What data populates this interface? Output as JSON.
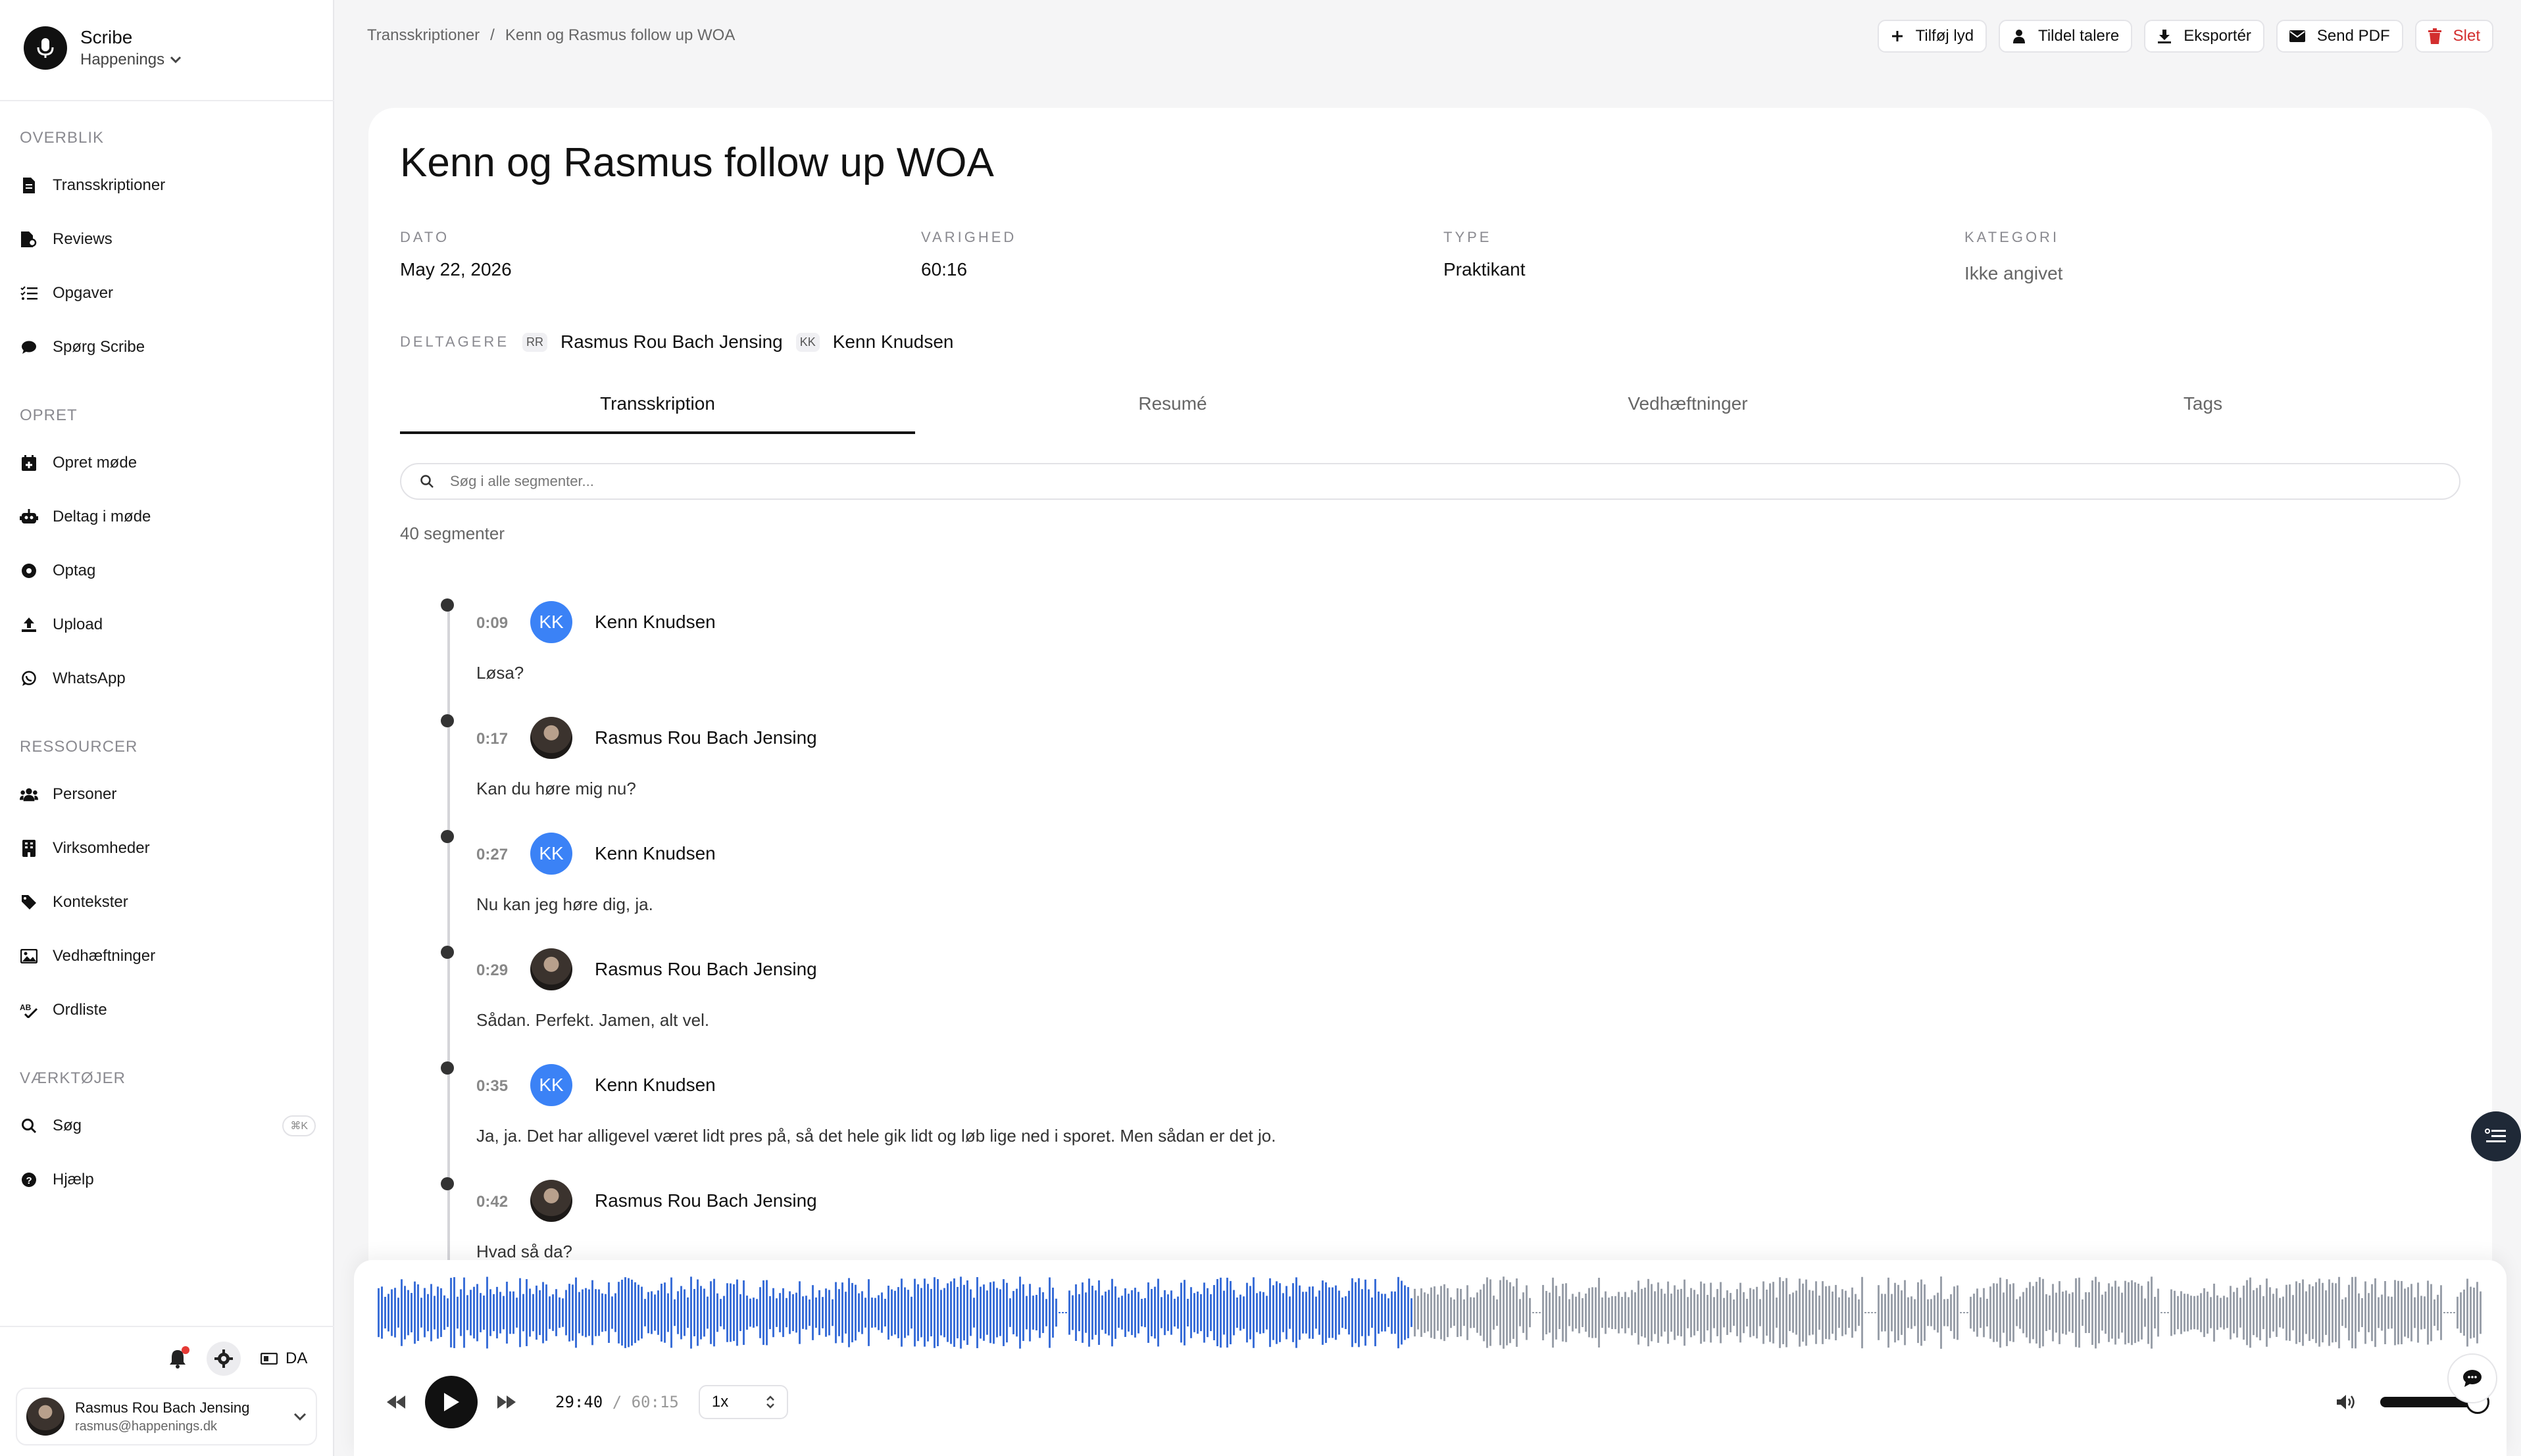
{
  "app": {
    "name": "Scribe",
    "org": "Happenings"
  },
  "sidebar": {
    "sections": [
      {
        "title": "OVERBLIK",
        "items": [
          {
            "label": "Transskriptioner",
            "icon": "file-icon"
          },
          {
            "label": "Reviews",
            "icon": "file-search-icon"
          },
          {
            "label": "Opgaver",
            "icon": "list-check-icon"
          },
          {
            "label": "Spørg Scribe",
            "icon": "chat-bubble-icon"
          }
        ]
      },
      {
        "title": "OPRET",
        "items": [
          {
            "label": "Opret møde",
            "icon": "calendar-plus-icon"
          },
          {
            "label": "Deltag i møde",
            "icon": "robot-icon"
          },
          {
            "label": "Optag",
            "icon": "record-icon"
          },
          {
            "label": "Upload",
            "icon": "upload-icon"
          },
          {
            "label": "WhatsApp",
            "icon": "whatsapp-icon"
          }
        ]
      },
      {
        "title": "RESSOURCER",
        "items": [
          {
            "label": "Personer",
            "icon": "people-icon"
          },
          {
            "label": "Virksomheder",
            "icon": "building-icon"
          },
          {
            "label": "Kontekster",
            "icon": "tag-icon"
          },
          {
            "label": "Vedhæftninger",
            "icon": "image-icon"
          },
          {
            "label": "Ordliste",
            "icon": "spellcheck-icon"
          }
        ]
      },
      {
        "title": "VÆRKTØJER",
        "items": [
          {
            "label": "Søg",
            "icon": "search-icon",
            "shortcut": "⌘K"
          },
          {
            "label": "Hjælp",
            "icon": "help-icon"
          }
        ]
      }
    ],
    "language": "DA",
    "user": {
      "name": "Rasmus Rou Bach Jensing",
      "email": "rasmus@happenings.dk"
    }
  },
  "topbar": {
    "breadcrumb": [
      "Transskriptioner",
      "Kenn og Rasmus follow up WOA"
    ],
    "actions": {
      "add_audio": "Tilføj lyd",
      "assign_speakers": "Tildel talere",
      "export": "Eksportér",
      "send_pdf": "Send PDF",
      "delete": "Slet"
    }
  },
  "meeting": {
    "title": "Kenn og Rasmus follow up WOA",
    "meta": {
      "date_label": "DATO",
      "date": "May 22, 2026",
      "duration_label": "VARIGHED",
      "duration": "60:16",
      "type_label": "TYPE",
      "type": "Praktikant",
      "category_label": "KATEGORI",
      "category": "Ikke angivet"
    },
    "participants_label": "DELTAGERE",
    "participants": [
      {
        "initials": "RR",
        "name": "Rasmus Rou Bach Jensing"
      },
      {
        "initials": "KK",
        "name": "Kenn Knudsen"
      }
    ]
  },
  "tabs": [
    "Transskription",
    "Resumé",
    "Vedhæftninger",
    "Tags"
  ],
  "search": {
    "placeholder": "Søg i alle segmenter..."
  },
  "segment_count": "40 segmenter",
  "segments": [
    {
      "time": "0:09",
      "speaker": "Kenn Knudsen",
      "initials": "KK",
      "text": "Løsa?"
    },
    {
      "time": "0:17",
      "speaker": "Rasmus Rou Bach Jensing",
      "initials": "",
      "text": "Kan du høre mig nu?"
    },
    {
      "time": "0:27",
      "speaker": "Kenn Knudsen",
      "initials": "KK",
      "text": "Nu kan jeg høre dig, ja."
    },
    {
      "time": "0:29",
      "speaker": "Rasmus Rou Bach Jensing",
      "initials": "",
      "text": "Sådan. Perfekt. Jamen, alt vel."
    },
    {
      "time": "0:35",
      "speaker": "Kenn Knudsen",
      "initials": "KK",
      "text": "Ja, ja. Det har alligevel været lidt pres på, så det hele gik lidt og løb lige ned i sporet. Men sådan er det jo."
    },
    {
      "time": "0:42",
      "speaker": "Rasmus Rou Bach Jensing",
      "initials": "",
      "text": "Hvad så da?"
    }
  ],
  "player": {
    "current": "29:40",
    "separator": "/",
    "duration": "60:15",
    "speed": "1x",
    "progress": 0.492,
    "volume": 1.0,
    "played_color": "#3b6fd8",
    "unplayed_color": "#9aa0aa"
  }
}
